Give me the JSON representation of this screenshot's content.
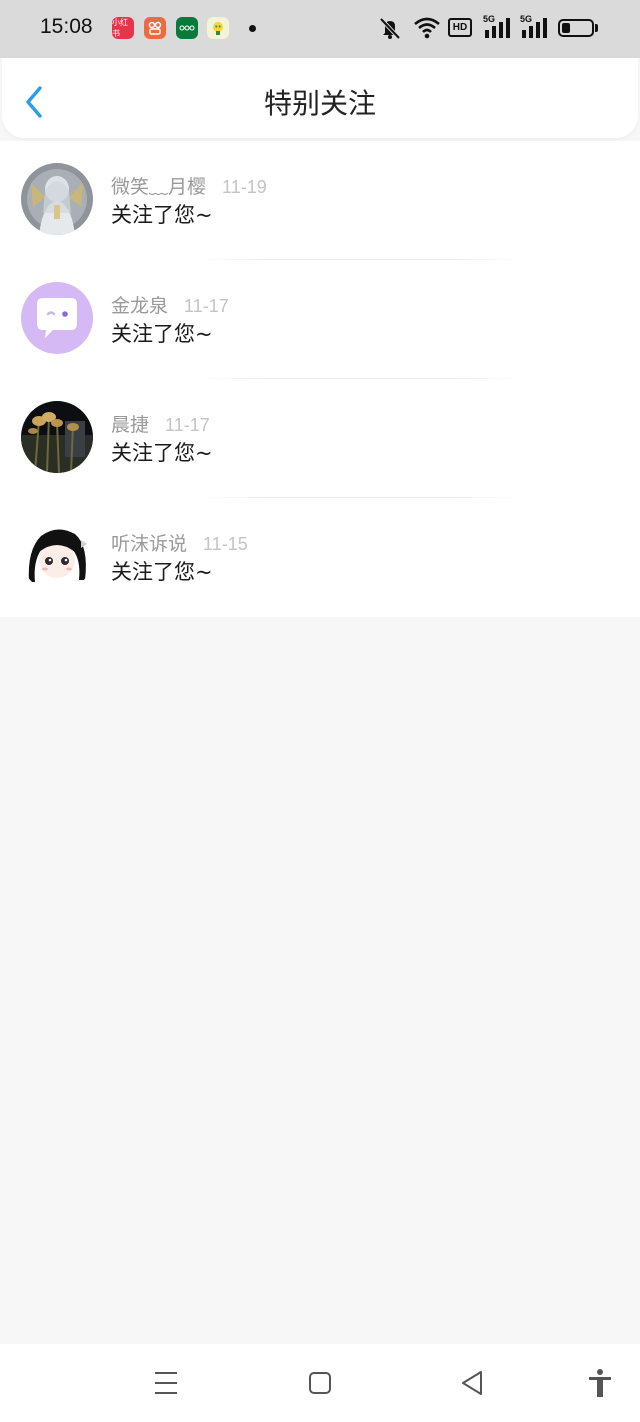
{
  "status_bar": {
    "time": "15:08",
    "app_badges": [
      {
        "icon": "xiaohongshu-app-icon",
        "label": "小红书",
        "color": "#e8344a"
      },
      {
        "icon": "video-app-icon",
        "label": "",
        "color": "#f06a3f"
      },
      {
        "icon": "wechat-pay-app-icon",
        "label": "",
        "color": "#0a7a3c"
      },
      {
        "icon": "cartoon-app-icon",
        "label": "",
        "color": "#f3f3d8"
      }
    ],
    "hd_label": "HD",
    "network_1": "5G",
    "network_2": "5G",
    "battery_level": 0.3
  },
  "header": {
    "title": "特别关注",
    "back_icon": "chevron-left-icon",
    "accent_color": "#2a9de8"
  },
  "notifications": [
    {
      "name": "微笑﹏月樱",
      "date": "11-19",
      "message": "关注了您~",
      "avatar": "angel-avatar"
    },
    {
      "name": "金龙泉",
      "date": "11-17",
      "message": "关注了您~",
      "avatar": "chat-bubble-avatar"
    },
    {
      "name": "晨捷",
      "date": "11-17",
      "message": "关注了您~",
      "avatar": "plant-photo-avatar"
    },
    {
      "name": "听沫诉说",
      "date": "11-15",
      "message": "关注了您~",
      "avatar": "anime-girl-avatar"
    }
  ],
  "nav_bar": {
    "buttons": [
      "menu-icon",
      "home-square-icon",
      "back-triangle-icon",
      "accessibility-icon"
    ]
  }
}
